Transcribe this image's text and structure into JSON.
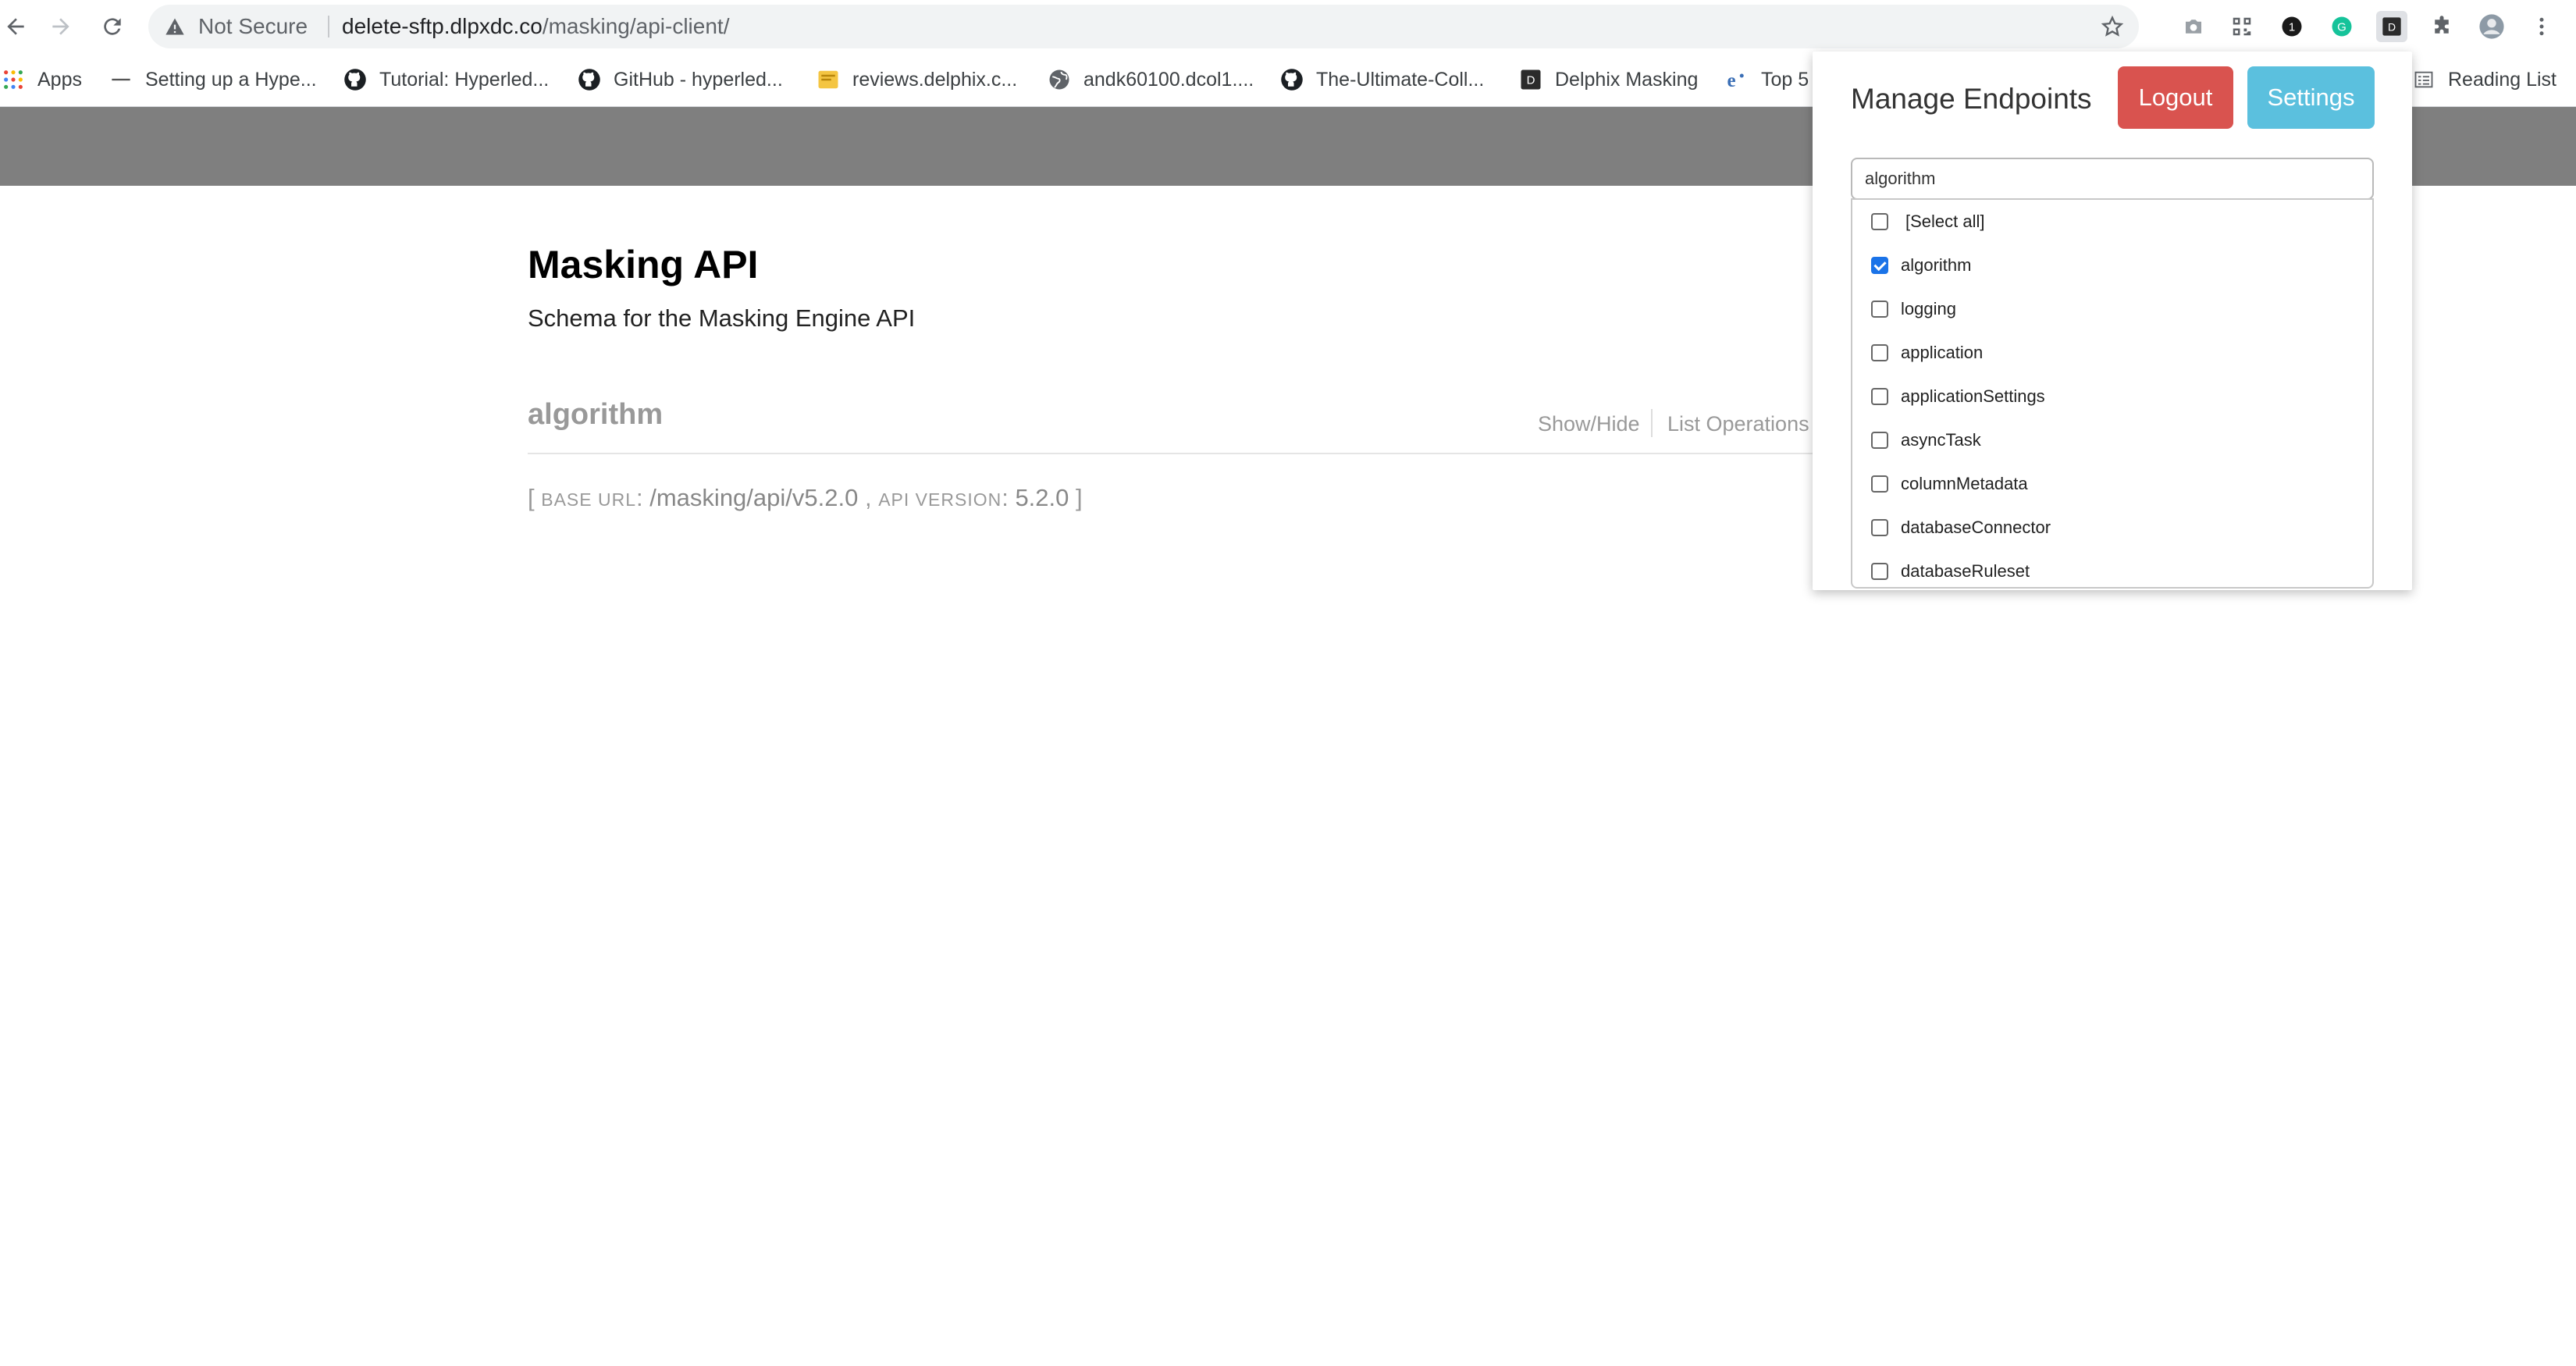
{
  "browser": {
    "not_secure_label": "Not Secure",
    "url_host": "delete-sftp.dlpxdc.co",
    "url_path": "/masking/api-client/",
    "reading_list_label": "Reading List"
  },
  "bookmarks": [
    {
      "label": "Apps",
      "icon": "apps-grid-icon"
    },
    {
      "label": "Setting up a Hype...",
      "icon": "dash-icon"
    },
    {
      "label": "Tutorial: Hyperled...",
      "icon": "github-icon"
    },
    {
      "label": "GitHub - hyperled...",
      "icon": "github-icon"
    },
    {
      "label": "reviews.delphix.c...",
      "icon": "yellow-square-icon"
    },
    {
      "label": "andk60100.dcol1....",
      "icon": "globe-icon"
    },
    {
      "label": "The-Ultimate-Coll...",
      "icon": "github-icon"
    },
    {
      "label": "Delphix Masking",
      "icon": "delphix-icon"
    },
    {
      "label": "Top 5",
      "icon": "e-icon"
    }
  ],
  "page": {
    "title": "Masking API",
    "description": "Schema for the Masking Engine API",
    "resource_name": "algorithm",
    "show_hide_label": "Show/Hide",
    "list_operations_label": "List Operations",
    "base_url_open": "[",
    "base_url_label": "Base URL",
    "base_url_value": "/masking/api/v5.2.0",
    "comma": ",",
    "api_version_label": "API Version",
    "api_version_value": "5.2.0",
    "base_url_close": "]"
  },
  "popup": {
    "title": "Manage Endpoints",
    "logout_label": "Logout",
    "settings_label": "Settings",
    "search_value": "algorithm",
    "items": [
      {
        "label": "[Select all]",
        "checked": false
      },
      {
        "label": "algorithm",
        "checked": true
      },
      {
        "label": "logging",
        "checked": false
      },
      {
        "label": "application",
        "checked": false
      },
      {
        "label": "applicationSettings",
        "checked": false
      },
      {
        "label": "asyncTask",
        "checked": false
      },
      {
        "label": "columnMetadata",
        "checked": false
      },
      {
        "label": "databaseConnector",
        "checked": false
      },
      {
        "label": "databaseRuleset",
        "checked": false
      }
    ]
  },
  "colors": {
    "header_band": "#7f7f7f",
    "logout": "#d9534f",
    "settings": "#5bc0de",
    "checkbox_checked": "#1a73e8"
  }
}
